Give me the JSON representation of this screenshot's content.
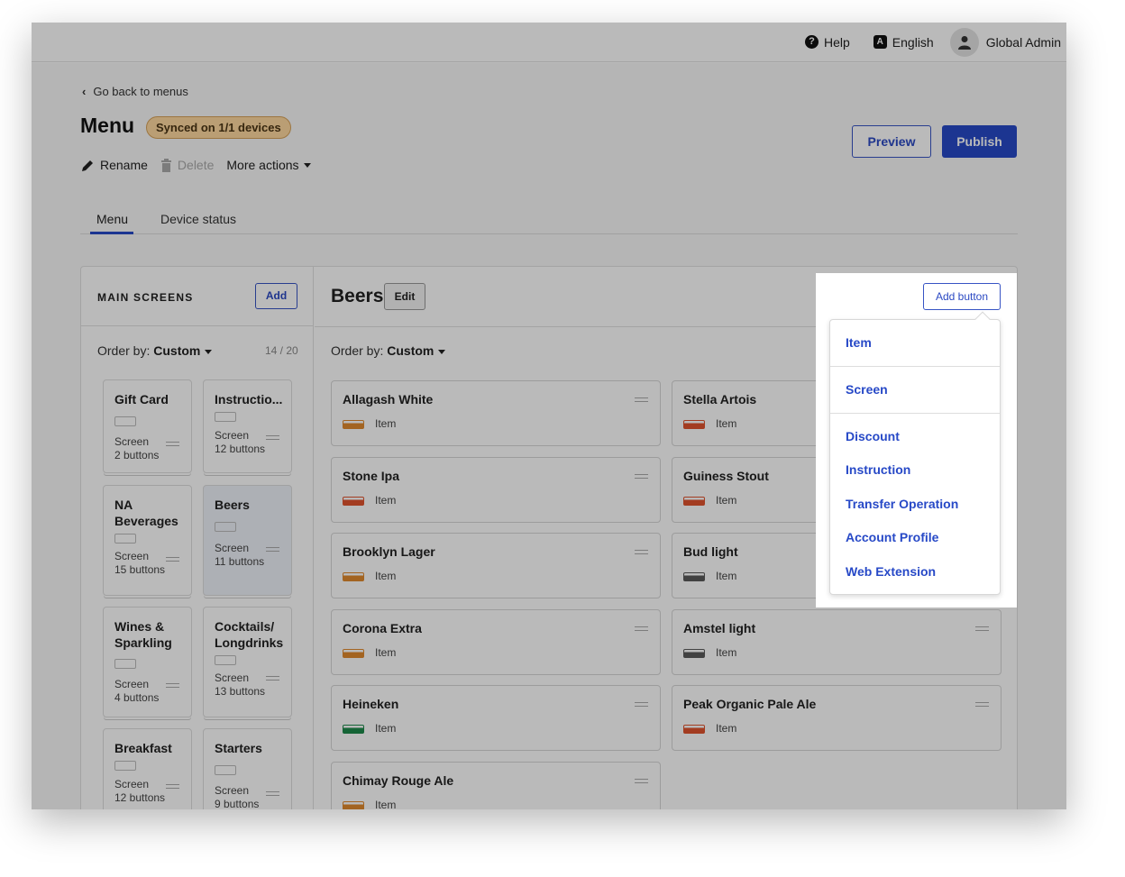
{
  "topbar": {
    "help": "Help",
    "language": "English",
    "user": "Global Admin"
  },
  "back_link": "Go back to menus",
  "page_title": "Menu",
  "sync_badge": "Synced on 1/1 devices",
  "actions": {
    "rename": "Rename",
    "delete": "Delete",
    "more": "More actions"
  },
  "buttons": {
    "preview": "Preview",
    "publish": "Publish"
  },
  "tabs": [
    "Menu",
    "Device status"
  ],
  "main_screens": {
    "title": "MAIN SCREENS",
    "add": "Add",
    "order_prefix": "Order by:",
    "order_value": "Custom",
    "count": "14 / 20",
    "screens": [
      {
        "name": "Gift Card",
        "type": "Screen",
        "buttons": "2 buttons"
      },
      {
        "name": "Instructio...",
        "type": "Screen",
        "buttons": "12 buttons"
      },
      {
        "name": "NA Beverages",
        "type": "Screen",
        "buttons": "15 buttons"
      },
      {
        "name": "Beers",
        "type": "Screen",
        "buttons": "11 buttons"
      },
      {
        "name": "Wines & Sparkling",
        "type": "Screen",
        "buttons": "4 buttons"
      },
      {
        "name": "Cocktails/ Longdrinks",
        "type": "Screen",
        "buttons": "13 buttons"
      },
      {
        "name": "Breakfast",
        "type": "Screen",
        "buttons": "12 buttons"
      },
      {
        "name": "Starters",
        "type": "Screen",
        "buttons": "9 buttons"
      }
    ]
  },
  "detail": {
    "title": "Beers",
    "edit": "Edit",
    "add_button": "Add button",
    "order_prefix": "Order by:",
    "order_value": "Custom",
    "items": [
      {
        "name": "Allagash White",
        "type": "Item",
        "color": "#e08a2e"
      },
      {
        "name": "Stella Artois",
        "type": "Item",
        "color": "#e0532e"
      },
      {
        "name": "Stone Ipa",
        "type": "Item",
        "color": "#e0532e"
      },
      {
        "name": "Guiness Stout",
        "type": "Item",
        "color": "#e0532e"
      },
      {
        "name": "Brooklyn Lager",
        "type": "Item",
        "color": "#e08a2e"
      },
      {
        "name": "Bud light",
        "type": "Item",
        "color": "#5a5a5a"
      },
      {
        "name": "Corona Extra",
        "type": "Item",
        "color": "#e08a2e"
      },
      {
        "name": "Amstel light",
        "type": "Item",
        "color": "#5a5a5a"
      },
      {
        "name": "Heineken",
        "type": "Item",
        "color": "#1e8a4a"
      },
      {
        "name": "Peak Organic Pale Ale",
        "type": "Item",
        "color": "#e0532e"
      },
      {
        "name": "Chimay Rouge Ale",
        "type": "Item",
        "color": "#e08a2e"
      }
    ]
  },
  "dropdown": [
    "Item",
    "Screen",
    "Discount",
    "Instruction",
    "Transfer Operation",
    "Account Profile",
    "Web Extension"
  ],
  "colors": {
    "accent": "#2749c7",
    "badge_bg": "#ffd9a0"
  }
}
